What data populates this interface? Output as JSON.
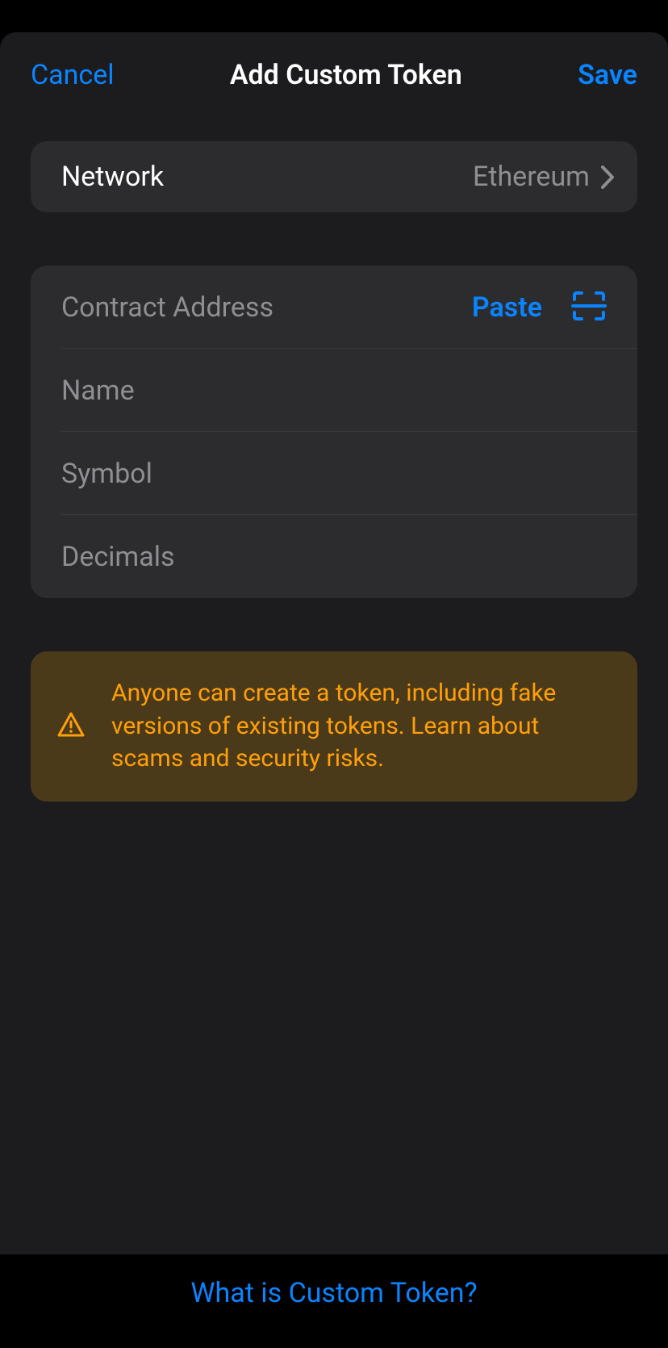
{
  "header": {
    "cancel_label": "Cancel",
    "title": "Add Custom Token",
    "save_label": "Save"
  },
  "network": {
    "label": "Network",
    "value": "Ethereum"
  },
  "form": {
    "contract_address_placeholder": "Contract Address",
    "paste_label": "Paste",
    "name_placeholder": "Name",
    "symbol_placeholder": "Symbol",
    "decimals_placeholder": "Decimals"
  },
  "warning": {
    "text": "Anyone can create a token, including fake versions of existing tokens. Learn about scams and security risks."
  },
  "footer": {
    "link_label": "What is Custom Token?"
  }
}
